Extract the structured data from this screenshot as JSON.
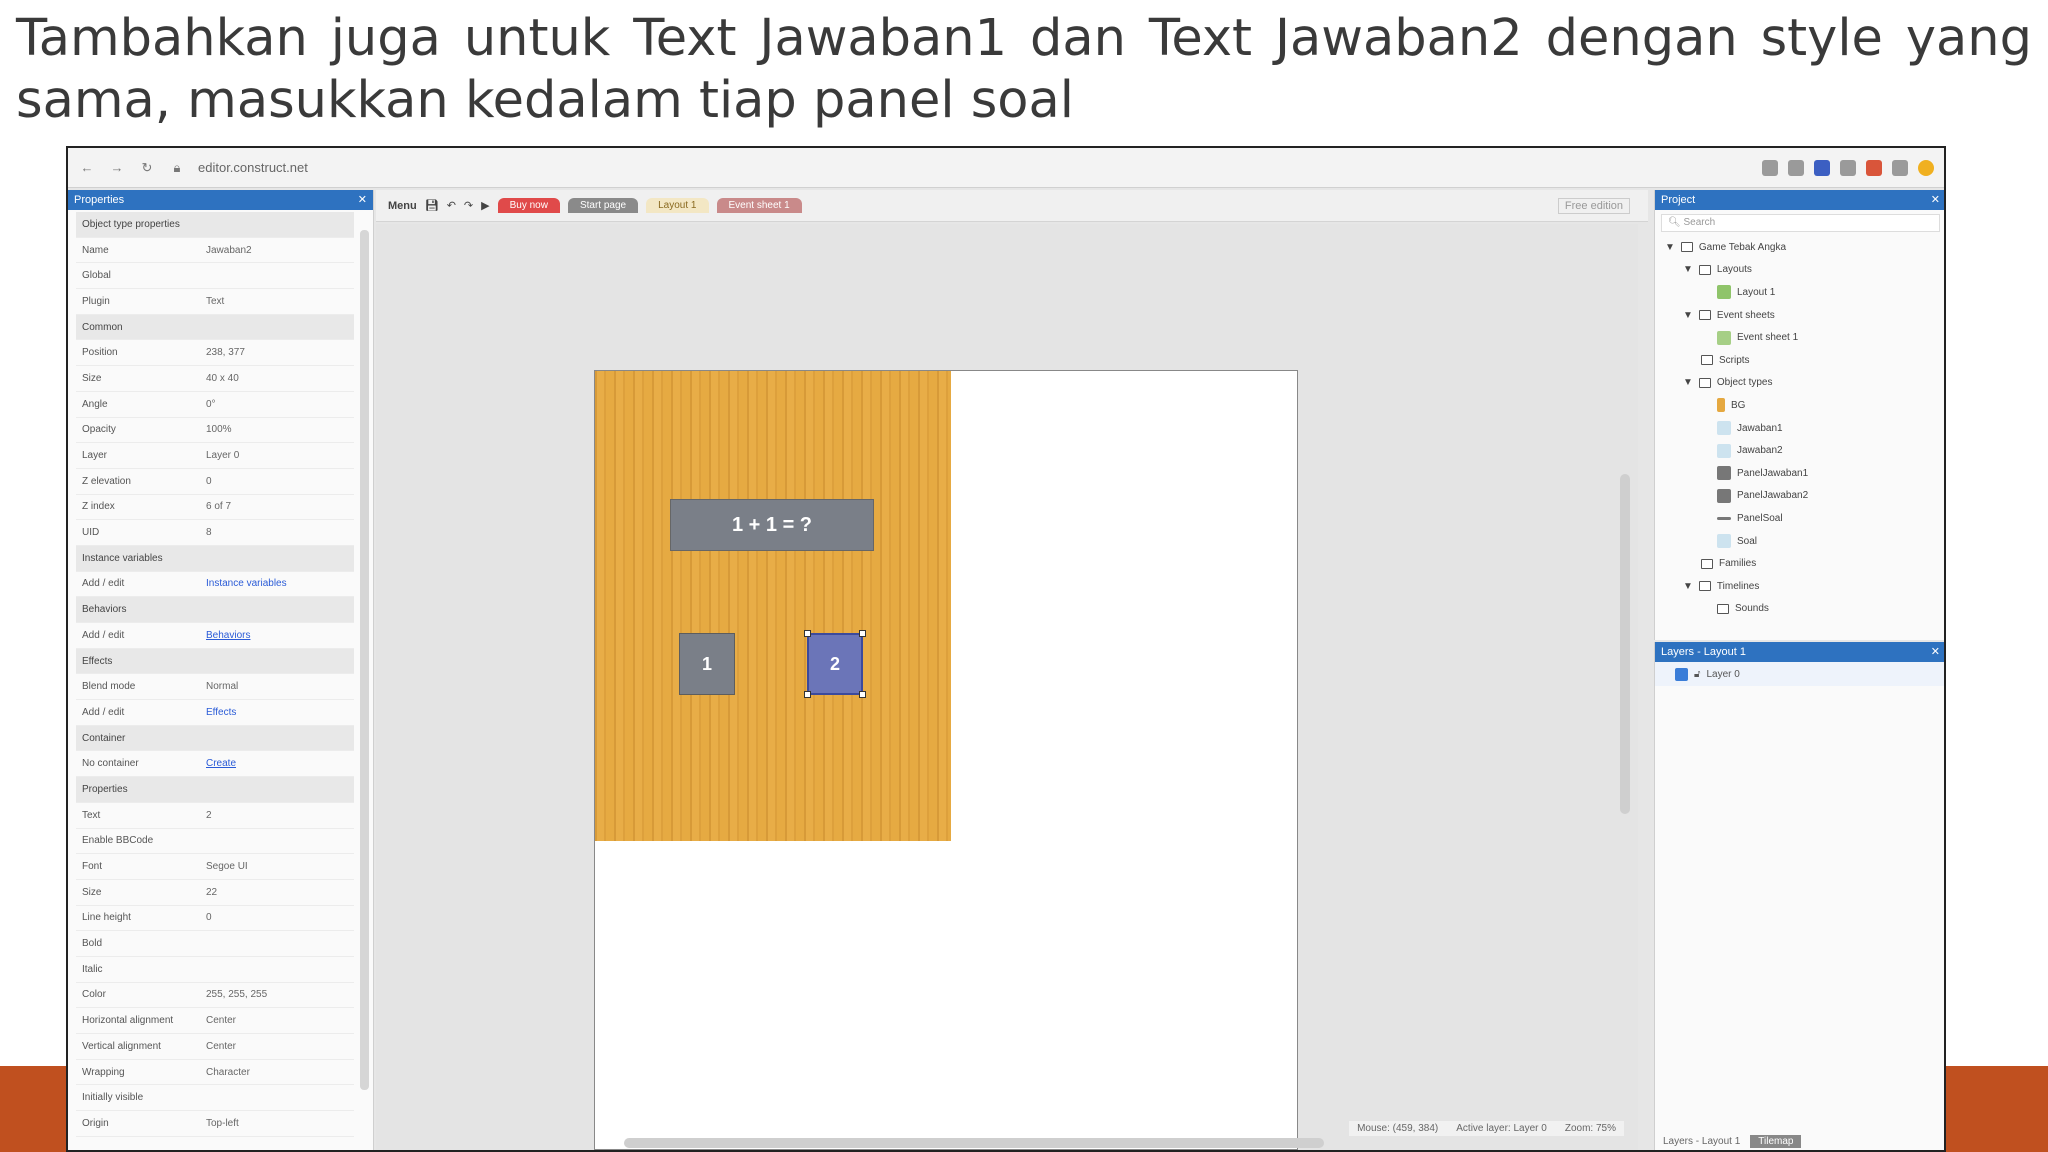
{
  "caption": "Tambahkan juga untuk Text Jawaban1 dan Text Jawaban2 dengan style yang sama, masukkan kedalam tiap panel soal",
  "browser": {
    "url": "editor.construct.net"
  },
  "properties_panel": {
    "title": "Properties",
    "rows": [
      {
        "key": "Object type properties",
        "value": "",
        "section": true
      },
      {
        "key": "Name",
        "value": "Jawaban2"
      },
      {
        "key": "Global",
        "value": ""
      },
      {
        "key": "Plugin",
        "value": "Text"
      },
      {
        "key": "Common",
        "value": "",
        "section": true
      },
      {
        "key": "Position",
        "value": "238, 377"
      },
      {
        "key": "Size",
        "value": "40 x 40"
      },
      {
        "key": "Angle",
        "value": "0°"
      },
      {
        "key": "Opacity",
        "value": "100%"
      },
      {
        "key": "Layer",
        "value": "Layer 0"
      },
      {
        "key": "Z elevation",
        "value": "0"
      },
      {
        "key": "Z index",
        "value": "6 of 7"
      },
      {
        "key": "UID",
        "value": "8"
      },
      {
        "key": "Instance variables",
        "value": "",
        "section": true
      },
      {
        "key": "Add / edit",
        "value": "Instance variables"
      },
      {
        "key": "Behaviors",
        "value": "",
        "section": true
      },
      {
        "key": "Add / edit",
        "value": "Behaviors"
      },
      {
        "key": "Effects",
        "value": "",
        "section": true
      },
      {
        "key": "Blend mode",
        "value": "Normal"
      },
      {
        "key": "Add / edit",
        "value": "Effects"
      },
      {
        "key": "Container",
        "value": "",
        "section": true
      },
      {
        "key": "No container",
        "value": "Create"
      },
      {
        "key": "Properties",
        "value": "",
        "section": true
      },
      {
        "key": "Text",
        "value": "2"
      },
      {
        "key": "Enable BBCode",
        "value": ""
      },
      {
        "key": "Font",
        "value": "Segoe UI"
      },
      {
        "key": "Size",
        "value": "22"
      },
      {
        "key": "Line height",
        "value": "0"
      },
      {
        "key": "Bold",
        "value": ""
      },
      {
        "key": "Italic",
        "value": ""
      },
      {
        "key": "Color",
        "value": "255, 255, 255"
      },
      {
        "key": "Horizontal alignment",
        "value": "Center"
      },
      {
        "key": "Vertical alignment",
        "value": "Center"
      },
      {
        "key": "Wrapping",
        "value": "Character"
      },
      {
        "key": "Initially visible",
        "value": ""
      },
      {
        "key": "Origin",
        "value": "Top-left"
      }
    ]
  },
  "toolbar": {
    "menu_label": "Menu",
    "tabs": [
      {
        "label": "Buy now",
        "color": "#e04a4a"
      },
      {
        "label": "Start page",
        "color": "#8a8a8a"
      },
      {
        "label": "Layout 1",
        "color": "#f3e7c4"
      },
      {
        "label": "Event sheet 1",
        "color": "#c98a8a"
      }
    ],
    "right_label": "Free edition"
  },
  "canvas": {
    "question_text": "1 + 1 = ?",
    "answer1_text": "1",
    "answer2_text": "2"
  },
  "status": {
    "mouse": "Mouse: (459, 384)",
    "active_layer": "Active layer: Layer 0",
    "zoom": "Zoom: 75%"
  },
  "project_panel": {
    "title": "Project",
    "search_placeholder": "Search",
    "tree": [
      {
        "label": "Game Tebak Angka",
        "indent": 0,
        "kind": "folder"
      },
      {
        "label": "Layouts",
        "indent": 1,
        "kind": "folder"
      },
      {
        "label": "Layout 1",
        "indent": 2,
        "kind": "layout"
      },
      {
        "label": "Event sheets",
        "indent": 1,
        "kind": "folder"
      },
      {
        "label": "Event sheet 1",
        "indent": 2,
        "kind": "events"
      },
      {
        "label": "Scripts",
        "indent": 1,
        "kind": "folder"
      },
      {
        "label": "Object types",
        "indent": 1,
        "kind": "folder"
      },
      {
        "label": "BG",
        "indent": 2,
        "kind": "sprite"
      },
      {
        "label": "Jawaban1",
        "indent": 2,
        "kind": "text"
      },
      {
        "label": "Jawaban2",
        "indent": 2,
        "kind": "text"
      },
      {
        "label": "PanelJawaban1",
        "indent": 2,
        "kind": "panel"
      },
      {
        "label": "PanelJawaban2",
        "indent": 2,
        "kind": "panel"
      },
      {
        "label": "PanelSoal",
        "indent": 2,
        "kind": "line"
      },
      {
        "label": "Soal",
        "indent": 2,
        "kind": "text"
      },
      {
        "label": "Families",
        "indent": 1,
        "kind": "folder"
      },
      {
        "label": "Timelines",
        "indent": 1,
        "kind": "folder"
      },
      {
        "label": "Sounds",
        "indent": 2,
        "kind": "folder"
      }
    ]
  },
  "layers_panel": {
    "title": "Layers - Layout 1",
    "layer_name": "Layer 0",
    "bottom_tabs": [
      "Layers - Layout 1",
      "Tilemap"
    ]
  }
}
